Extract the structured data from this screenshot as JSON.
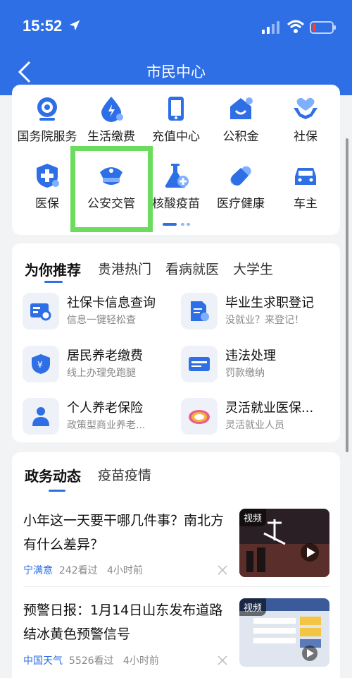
{
  "status_bar": {
    "time": "15:52"
  },
  "nav": {
    "title": "市民中心"
  },
  "grid": [
    {
      "label": "国务院服务",
      "icon": "state-council-icon"
    },
    {
      "label": "生活缴费",
      "icon": "utility-payment-icon"
    },
    {
      "label": "充值中心",
      "icon": "top-up-icon"
    },
    {
      "label": "公积金",
      "icon": "housing-fund-icon"
    },
    {
      "label": "社保",
      "icon": "social-security-icon"
    },
    {
      "label": "医保",
      "icon": "medical-insurance-icon"
    },
    {
      "label": "公安交管",
      "icon": "police-traffic-icon"
    },
    {
      "label": "核酸疫苗",
      "icon": "nucleic-vaccine-icon"
    },
    {
      "label": "医疗健康",
      "icon": "health-icon"
    },
    {
      "label": "车主",
      "icon": "car-owner-icon"
    }
  ],
  "recommend": {
    "tabs": [
      "为你推荐",
      "贵港热门",
      "看病就医",
      "大学生"
    ],
    "items": [
      {
        "title": "社保卡信息查询",
        "subtitle": "信息一键轻松查",
        "icon": "social-card-query-icon"
      },
      {
        "title": "毕业生求职登记",
        "subtitle": "没就业？来登记！",
        "icon": "graduate-registration-icon"
      },
      {
        "title": "居民养老缴费",
        "subtitle": "线上办理免跑腿",
        "icon": "pension-payment-icon"
      },
      {
        "title": "违法处理",
        "subtitle": "罚款缴纳",
        "icon": "traffic-violation-icon"
      },
      {
        "title": "个人养老保险",
        "subtitle": "政策型商业养老...",
        "icon": "personal-pension-icon"
      },
      {
        "title": "灵活就业医保...",
        "subtitle": "灵活就业人员",
        "icon": "flexible-employment-icon"
      }
    ]
  },
  "news": {
    "tabs": [
      "政务动态",
      "疫苗疫情"
    ],
    "items": [
      {
        "title": "小年这一天要干哪几件事？南北方有什么差异？",
        "source": "宁满意",
        "views": "242看过",
        "time": "4小时前",
        "badge": "视频"
      },
      {
        "title": "预警日报：1月14日山东发布道路结冰黄色预警信号",
        "source": "中国天气",
        "views": "5526看过",
        "time": "4小时前",
        "badge": "视频"
      }
    ]
  },
  "colors": {
    "primary": "#2e6fe6",
    "highlight": "#6cdc5e"
  }
}
